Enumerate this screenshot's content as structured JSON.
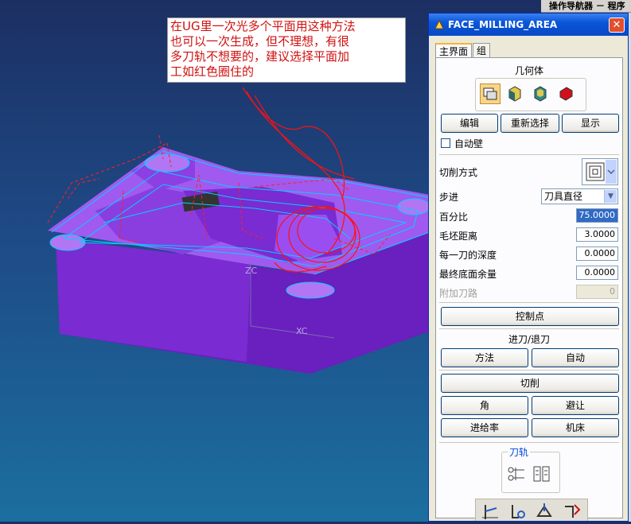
{
  "annotation": {
    "line1": "在UG里一次光多个平面用这种方法",
    "line2": "也可以一次生成，但不理想，有很",
    "line3": "多刀轨不想要的，建议选择平面加",
    "line4": "工如红色圈住的"
  },
  "viewport": {
    "axis_z": "ZC",
    "axis_x": "XC"
  },
  "navigator": {
    "title": "操作导航器 － 程序"
  },
  "dialog": {
    "title": "FACE_MILLING_AREA",
    "close": "✕",
    "tabs": [
      {
        "label": "主界面",
        "active": true
      },
      {
        "label": "组",
        "active": false
      }
    ],
    "geometry": {
      "heading": "几何体",
      "icons": [
        "part-geometry-icon",
        "blank-geometry-icon",
        "check-geometry-icon",
        "trim-geometry-icon"
      ],
      "edit": "编辑",
      "reselect": "重新选择",
      "display": "显示"
    },
    "auto_wall": {
      "label": "自动壁",
      "checked": false
    },
    "cut_method": {
      "label": "切削方式",
      "icon": "follow-periphery-icon"
    },
    "stepover": {
      "label": "步进",
      "value": "刀具直径"
    },
    "percent": {
      "label": "百分比",
      "value": "75.0000"
    },
    "blank_distance": {
      "label": "毛坯距离",
      "value": "3.0000"
    },
    "depth_per_cut": {
      "label": "每一刀的深度",
      "value": "0.0000"
    },
    "final_floor_stock": {
      "label": "最终底面余量",
      "value": "0.0000"
    },
    "extra_passes": {
      "label": "附加刀路",
      "value": "0"
    },
    "control_points": "控制点",
    "engage_retract": {
      "heading": "进刀/退刀",
      "method": "方法",
      "auto": "自动"
    },
    "cutting": "切削",
    "corner": "角",
    "avoidance": "避让",
    "feedrate": "进给率",
    "machine": "机床",
    "toolpath": {
      "heading": "刀轨",
      "icons": [
        "generate-toolpath-icon",
        "list-toolpath-icon"
      ]
    }
  },
  "bottom_icons": [
    "replay-icon",
    "verify-icon",
    "simulate-icon",
    "postprocess-icon"
  ],
  "colors": {
    "part": "#8a2be2",
    "toolpath": "#00d0ff",
    "annotation_red": "#d01010",
    "titlebar": "#0a56d8"
  }
}
